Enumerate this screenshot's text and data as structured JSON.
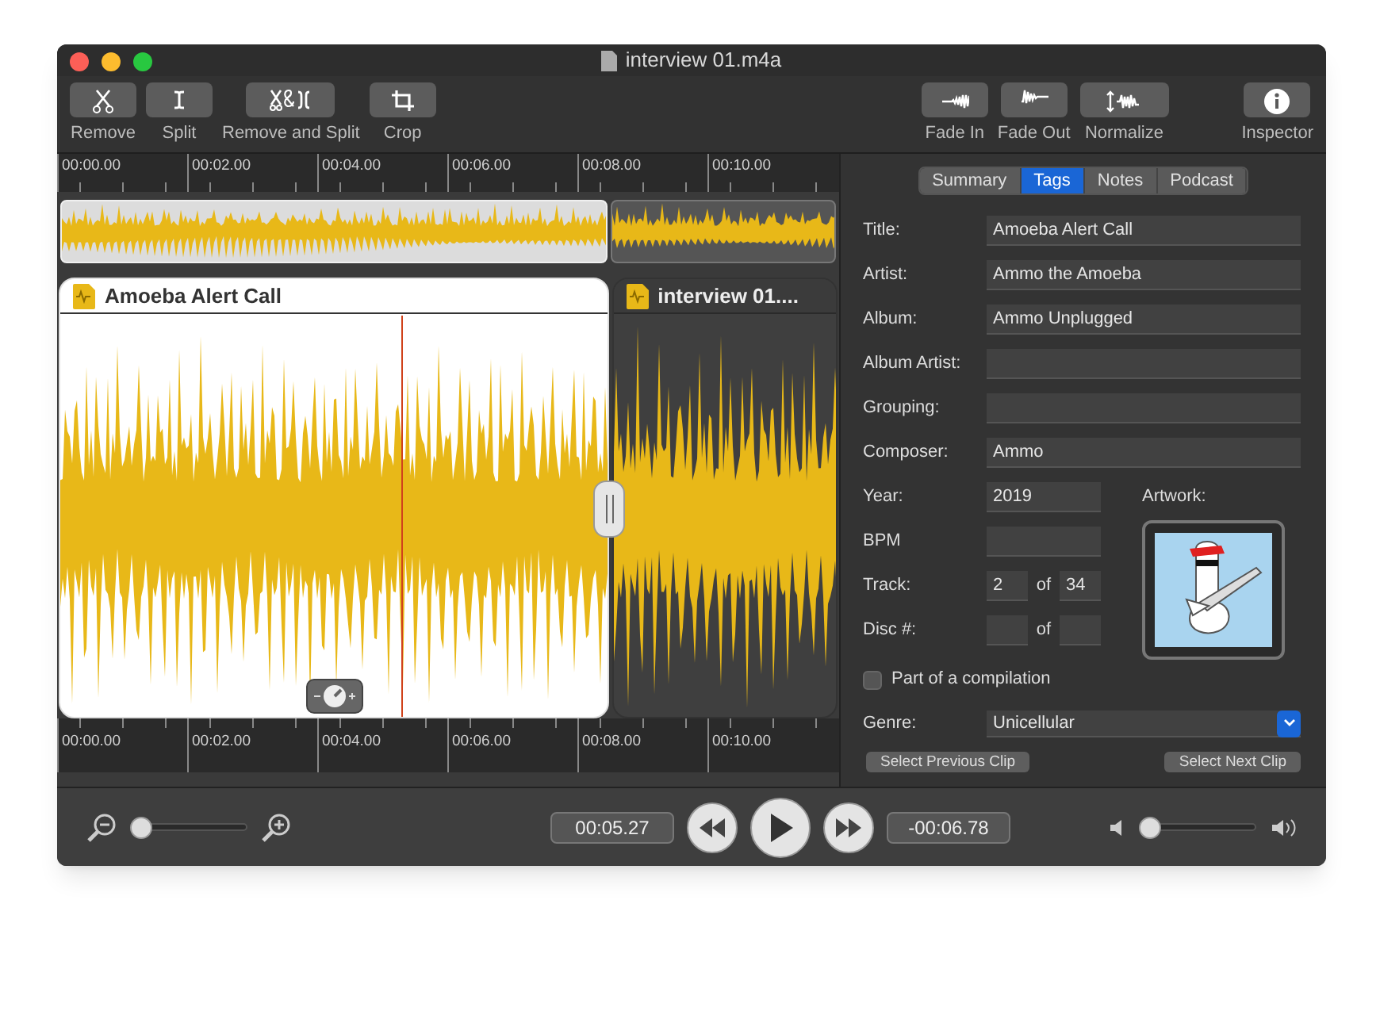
{
  "window": {
    "title": "interview 01.m4a"
  },
  "toolbar": {
    "left": [
      {
        "label": "Remove",
        "kind": "remove"
      },
      {
        "label": "Split",
        "kind": "split"
      },
      {
        "label": "Remove and Split",
        "kind": "remove_split"
      },
      {
        "label": "Crop",
        "kind": "crop"
      }
    ],
    "right": [
      {
        "label": "Fade In",
        "kind": "fade_in"
      },
      {
        "label": "Fade Out",
        "kind": "fade_out"
      },
      {
        "label": "Normalize",
        "kind": "normalize"
      },
      {
        "label": "Inspector",
        "kind": "inspector"
      }
    ]
  },
  "ruler_top": [
    "00:00.00",
    "00:02.00",
    "00:04.00",
    "00:06.00",
    "00:08.00",
    "00:10.00"
  ],
  "clips": [
    {
      "title": "Amoeba Alert Call",
      "selected": true
    },
    {
      "title": "interview 01....",
      "selected": false
    }
  ],
  "ruler_bottom": [
    "00:00.00",
    "00:02.00",
    "00:04.00",
    "00:06.00",
    "00:08.00",
    "00:10.00"
  ],
  "tabs": [
    {
      "label": "Summary",
      "selected": false
    },
    {
      "label": "Tags",
      "selected": true
    },
    {
      "label": "Notes",
      "selected": false
    },
    {
      "label": "Podcast",
      "selected": false
    }
  ],
  "tags": {
    "fields": [
      {
        "label": "Title:",
        "value": "Amoeba Alert Call"
      },
      {
        "label": "Artist:",
        "value": "Ammo the Amoeba"
      },
      {
        "label": "Album:",
        "value": "Ammo Unplugged"
      },
      {
        "label": "Album Artist:"
      },
      {
        "label": "Grouping:"
      },
      {
        "label": "Composer:",
        "value": "Ammo"
      }
    ],
    "year": {
      "label": "Year:",
      "value": "2019"
    },
    "bpm": {
      "label": "BPM"
    },
    "track": {
      "label": "Track:",
      "number": "2",
      "of": "of",
      "total": "34"
    },
    "disc": {
      "label": "Disc #:",
      "of": "of"
    },
    "artwork_label": "Artwork:",
    "compilation": {
      "label": "Part of a compilation",
      "checked": false
    },
    "genre": {
      "label": "Genre:",
      "value": "Unicellular"
    },
    "buttons": [
      "Select Previous Clip",
      "Select Next Clip"
    ]
  },
  "transport": {
    "zoom": {
      "level": 0.0
    },
    "elapsed": "00:05.27",
    "remaining": "-00:06.78",
    "volume": {
      "level": 0.0
    }
  }
}
